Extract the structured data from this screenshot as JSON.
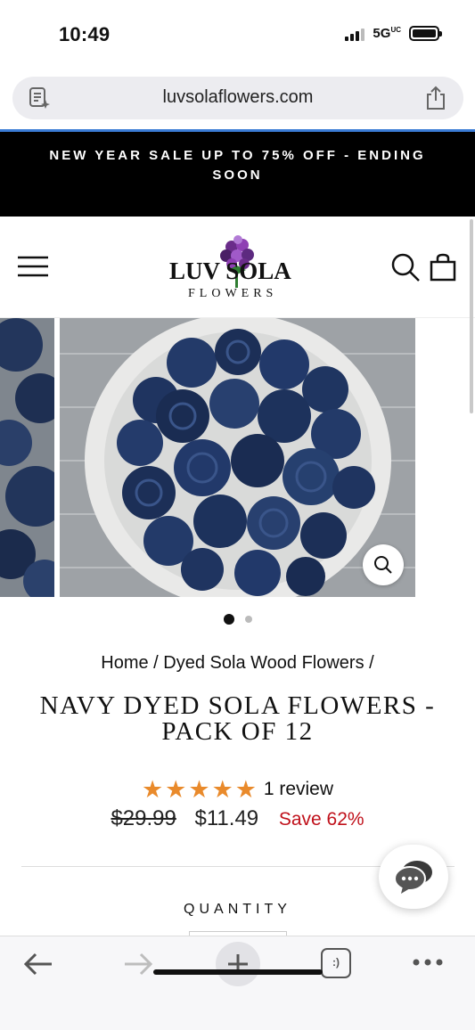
{
  "status_bar": {
    "time": "10:49",
    "network": "5G",
    "network_sup": "UC",
    "icons": [
      "signal-icon",
      "battery-icon"
    ]
  },
  "browser": {
    "url": "luvsolaflowers.com",
    "icons": [
      "reader-mode-icon",
      "share-icon"
    ],
    "accent_color": "#3a7bd5"
  },
  "announcement": {
    "text": "NEW YEAR SALE UP TO 75% OFF - ENDING SOON"
  },
  "header": {
    "logo_top": "LUV SOLA",
    "logo_bottom": "FLOWERS",
    "icons": [
      "menu-icon",
      "search-icon",
      "cart-icon"
    ]
  },
  "carousel": {
    "slide_count": 2,
    "active_index": 0,
    "icons": [
      "zoom-icon"
    ]
  },
  "breadcrumb": {
    "home": "Home",
    "separator": " / ",
    "category": "Dyed Sola Wood Flowers",
    "trailing": " /"
  },
  "product": {
    "title": "NAVY DYED SOLA FLOWERS - PACK OF 12",
    "stars": "★★★★★",
    "rating": 5,
    "review_text": "1 review",
    "price_original": "$29.99",
    "price_sale": "$11.49",
    "savings": "Save 62%",
    "quantity_label": "QUANTITY",
    "star_color": "#e98a2b",
    "savings_color": "#c0111b"
  },
  "chat": {
    "icons": [
      "chat-icon"
    ]
  },
  "toolbar": {
    "tabs_label": ":)",
    "icons": [
      "back-arrow-icon",
      "forward-arrow-icon",
      "plus-icon",
      "tabs-icon",
      "more-icon"
    ]
  }
}
